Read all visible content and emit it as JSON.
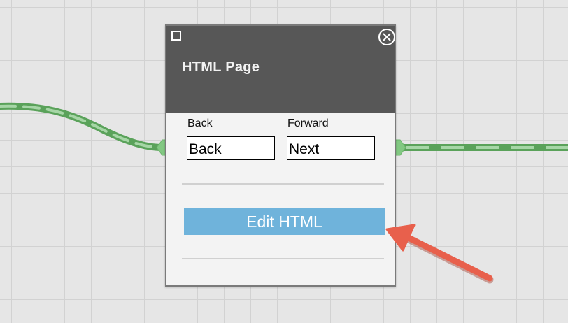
{
  "node": {
    "title": "HTML Page",
    "back_label": "Back",
    "back_value": "Back",
    "forward_label": "Forward",
    "forward_value": "Next",
    "edit_button_label": "Edit HTML"
  },
  "colors": {
    "header_bg": "#575757",
    "button_bg": "#6fb3db",
    "connector": "#5aa25a",
    "connector_dash": "#a6d6a6",
    "annotation_arrow": "#e8604c"
  },
  "icons": {
    "select": "square-checkbox-icon",
    "close": "circle-x-close-icon",
    "input_port": "port-connector-icon",
    "output_port": "port-connector-icon"
  }
}
